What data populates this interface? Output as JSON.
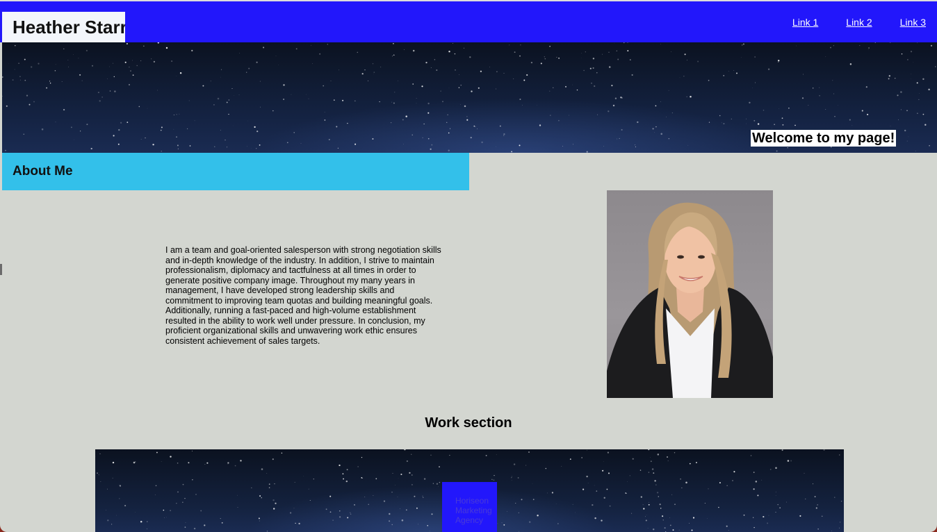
{
  "header": {
    "site_title": "Heather Starr",
    "nav_links": [
      "Link 1",
      "Link 2",
      "Link 3"
    ]
  },
  "hero": {
    "welcome": "Welcome to my page!"
  },
  "about": {
    "heading": "About Me",
    "body": "I am a team and goal-oriented salesperson with strong negotiation skills and in-depth knowledge of the industry. In addition, I strive to maintain professionalism, diplomacy and tactfulness at all times in order to generate positive company image. Throughout my many years in management, I have developed strong leadership skills and commitment to improving team quotas and building meaningful goals. Additionally, running a fast-paced and high-volume establishment resulted in the ability to work well under pressure. In conclusion, my proficient organizational skills and unwavering work ethic ensures consistent achievement of sales targets."
  },
  "work": {
    "heading": "Work section",
    "project_label": "Horiseon Marketing Agency"
  },
  "colors": {
    "header_bg": "#2217fb",
    "about_bar": "#33c0ea",
    "page_bg": "#d3d6d0"
  }
}
